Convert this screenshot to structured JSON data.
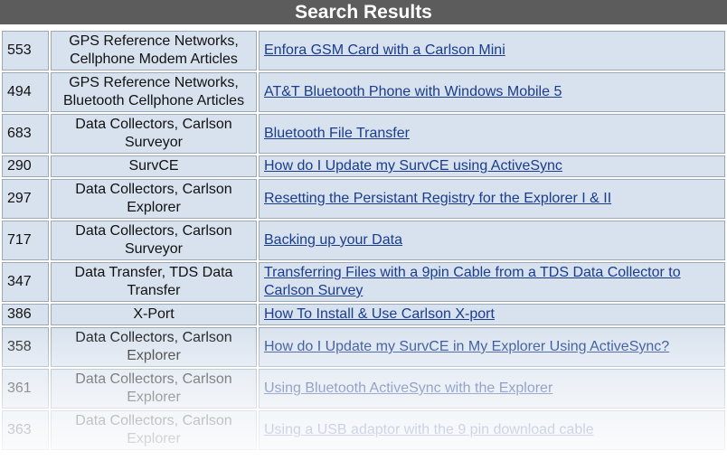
{
  "header": {
    "title": "Search Results"
  },
  "results": [
    {
      "id": "553",
      "category": "GPS Reference Networks, Cellphone Modem Articles",
      "title": "Enfora GSM Card with a Carlson Mini"
    },
    {
      "id": "494",
      "category": "GPS Reference Networks, Bluetooth Cellphone Articles",
      "title": "AT&T Bluetooth Phone with Windows Mobile 5"
    },
    {
      "id": "683",
      "category": "Data Collectors, Carlson Surveyor",
      "title": "Bluetooth File Transfer"
    },
    {
      "id": "290",
      "category": "SurvCE",
      "title": "How do I Update my SurvCE using ActiveSync"
    },
    {
      "id": "297",
      "category": "Data Collectors, Carlson Explorer",
      "title": "Resetting the Persistant Registry for the Explorer I & II"
    },
    {
      "id": "717",
      "category": "Data Collectors, Carlson Surveyor",
      "title": "Backing up your Data"
    },
    {
      "id": "347",
      "category": "Data Transfer, TDS Data Transfer",
      "title": "Transferring Files with a 9pin Cable from a TDS Data Collector to Carlson Survey"
    },
    {
      "id": "386",
      "category": "X-Port",
      "title": "How To Install & Use Carlson X-port"
    },
    {
      "id": "358",
      "category": "Data Collectors, Carlson Explorer",
      "title": "How do I Update my SurvCE in My Explorer Using ActiveSync?"
    },
    {
      "id": "361",
      "category": "Data Collectors, Carlson Explorer",
      "title": "Using Bluetooth ActiveSync with the Explorer"
    },
    {
      "id": "363",
      "category": "Data Collectors, Carlson Explorer",
      "title": "Using a USB adaptor with the 9 pin download cable"
    }
  ]
}
